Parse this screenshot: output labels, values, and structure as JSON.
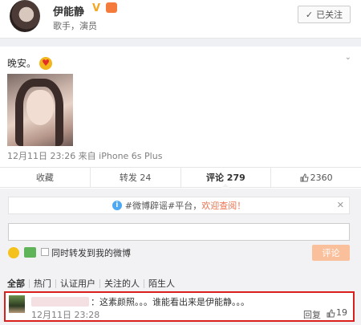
{
  "profile": {
    "name": "伊能静",
    "verified_badge": "V",
    "description": "歌手，演员",
    "follow_button": "已关注",
    "follow_icon": "✓"
  },
  "post": {
    "text": "晚安。",
    "meta": "12月11日 23:26 来自 iPhone 6s Plus",
    "more_icon": "chevron-down-icon"
  },
  "actions": {
    "favorite": "收藏",
    "repost": "转发 24",
    "comment": "评论 279",
    "like": "2360"
  },
  "comments": {
    "notice_prefix": "#微博辟谣#平台，",
    "notice_link": "欢迎查阅！",
    "notice_close": "✕",
    "repost_label": "同时转发到我的微博",
    "submit_label": "评论",
    "filters": [
      "全部",
      "热门",
      "认证用户",
      "关注的人",
      "陌生人"
    ],
    "item": {
      "text": "：这素颜照。。。谁能看出来是伊能静。。。",
      "time": "12月11日 23:28",
      "reply": "回复",
      "likes": "19"
    }
  },
  "colors": {
    "accent": "#eb7350",
    "highlight_border": "#d9201d",
    "submit_disabled": "#fabf9b"
  }
}
